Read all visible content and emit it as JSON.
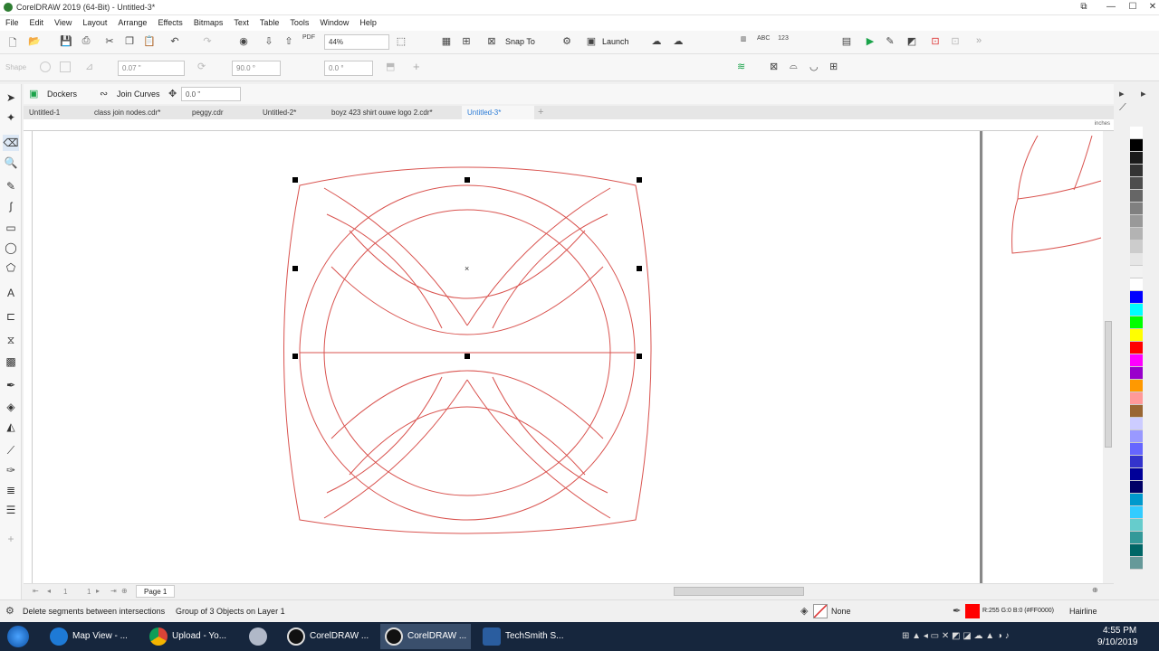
{
  "titlebar": {
    "title": "CorelDRAW 2019 (64-Bit) - Untitled-3*"
  },
  "menu": [
    "File",
    "Edit",
    "View",
    "Layout",
    "Arrange",
    "Effects",
    "Bitmaps",
    "Text",
    "Table",
    "Tools",
    "Window",
    "Help"
  ],
  "toolbar": {
    "zoom_value": "44%",
    "snap_to_label": "Snap To",
    "launch_label": "Launch"
  },
  "propbar": {
    "outline_width": "0.07 \"",
    "rotation": "90.0 °",
    "angle": "0.0 °",
    "shape_label": "Shape"
  },
  "propbar2": {
    "dockers_label": "Dockers",
    "join_curves_label": "Join Curves",
    "distance_value": "0.0 \""
  },
  "tabs": [
    {
      "label": "Untitled-1",
      "active": false
    },
    {
      "label": "class join nodes.cdr*",
      "active": false
    },
    {
      "label": "peggy.cdr",
      "active": false
    },
    {
      "label": "Untitled-2*",
      "active": false
    },
    {
      "label": "boyz 423 shirt ouwe logo 2.cdr*",
      "active": false
    },
    {
      "label": "Untitled-3*",
      "active": true
    }
  ],
  "ruler": {
    "units": "inches"
  },
  "pagebar": {
    "page_of": "1",
    "page_total": "1",
    "page_tab": "Page 1"
  },
  "status": {
    "hint": "Delete segments between intersections",
    "selection": "Group of 3 Objects on Layer 1",
    "fill": "None",
    "outline_color": "R:255 G:0 B:0 (#FF0000)",
    "outline_width": "Hairline"
  },
  "taskbar": {
    "tasks": [
      "Map View - ...",
      "Upload - Yo...",
      "CorelDRAW ...",
      "CorelDRAW ...",
      "TechSmith S..."
    ],
    "time": "4:55 PM",
    "date": "9/10/2019"
  },
  "colors": {
    "outline": "#d9534f",
    "accent": "#2a7bd6",
    "palette": [
      "#ffffff",
      "#000000",
      "#1a1a1a",
      "#333333",
      "#4d4d4d",
      "#666666",
      "#808080",
      "#999999",
      "#b3b3b3",
      "#cccccc",
      "#e6e6e6",
      "#f2f2f2",
      "#ffffff",
      "#0000ff",
      "#00ffff",
      "#00ff00",
      "#ffff00",
      "#ff0000",
      "#ff00ff",
      "#9900cc",
      "#ff9900",
      "#ff9999",
      "#996633",
      "#ccccff",
      "#9999ff",
      "#6666ff",
      "#3333cc",
      "#000099",
      "#000066",
      "#0099cc",
      "#33ccff",
      "#66cccc",
      "#339999",
      "#006666",
      "#669999"
    ]
  }
}
